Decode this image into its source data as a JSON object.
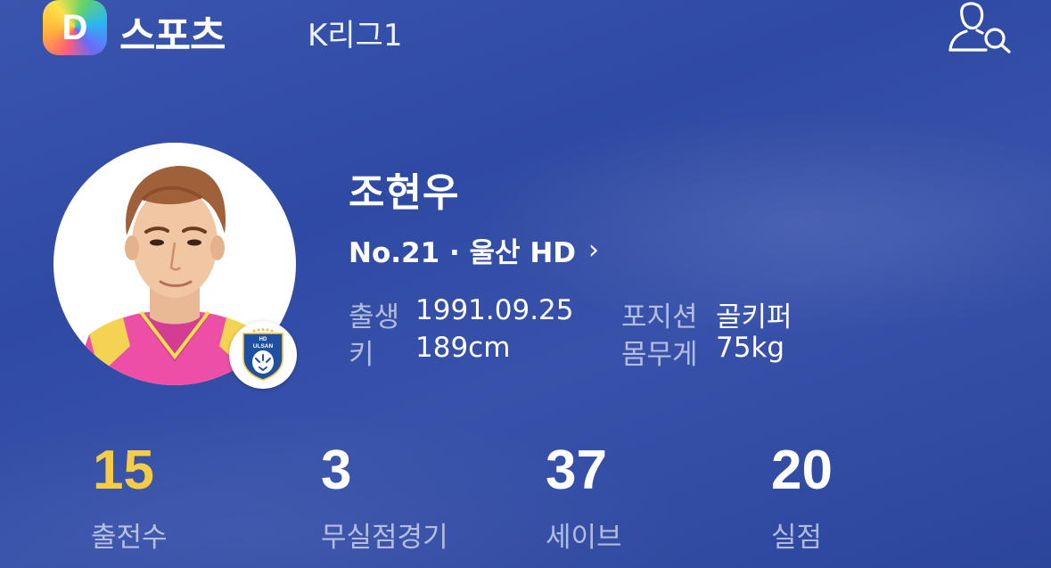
{
  "header": {
    "logo_letter": "D",
    "brand": "스포츠",
    "league": "K리그1",
    "icons": {
      "logo": "daum-logo-icon",
      "user_search": "user-search-icon"
    }
  },
  "player": {
    "name": "조현우",
    "team_line": "No.21 · 울산 HD",
    "chevron": "›",
    "badge_text": "ULSAN",
    "badge_top": "HD",
    "info": [
      {
        "label": "출생",
        "value": "1991.09.25"
      },
      {
        "label": "포지션",
        "value": "골키퍼"
      },
      {
        "label": "키",
        "value": "189cm"
      },
      {
        "label": "몸무게",
        "value": "75kg"
      }
    ]
  },
  "stats": [
    {
      "value": "15",
      "label": "출전수",
      "highlight": true
    },
    {
      "value": "3",
      "label": "무실점경기",
      "highlight": false
    },
    {
      "value": "37",
      "label": "세이브",
      "highlight": false
    },
    {
      "value": "20",
      "label": "실점",
      "highlight": false
    }
  ],
  "colors": {
    "background": "#3450a8",
    "highlight": "#f6cc47",
    "jersey": "#ee4fa6",
    "collar": "#f4e04a"
  }
}
